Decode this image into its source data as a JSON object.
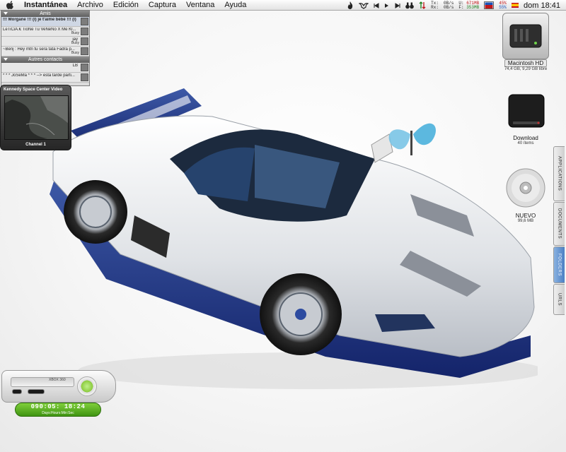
{
  "menubar": {
    "app_name": "Instantánea",
    "menus": [
      "Archivo",
      "Edición",
      "Captura",
      "Ventana",
      "Ayuda"
    ],
    "net": {
      "tx_label": "Tx:",
      "rx_label": "Rx:",
      "tx_val": "0B/s",
      "rx_val": "0B/s"
    },
    "mem": {
      "u_label": "U:",
      "f_label": "F:",
      "u_val": "671MB",
      "f_val": "353MB"
    },
    "cpu": {
      "top": "45%",
      "bottom": "55%"
    },
    "clock": "dom 18:41",
    "icons": [
      "apple-icon",
      "flame-icon",
      "bird-icon",
      "previous-track-icon",
      "play-pause-icon",
      "next-track-icon",
      "binoculars-icon",
      "network-activity-icon",
      "cpu-meter-icon",
      "spain-flag-icon"
    ]
  },
  "buddy_list": {
    "group1": "Amis",
    "group2": "Autres contacts",
    "contacts": [
      {
        "name": "!!! Morgane !!! (l) je t'aime bébé !!! (l)",
        "status": ""
      },
      {
        "name": "LeTiCiA.€ TioNe Tu VeNeNo X Me Kl...",
        "status": "Busy"
      },
      {
        "name": "",
        "status": "Busy",
        "sub": "jay"
      },
      {
        "name": "~Benj : Hey mtn tu sera tata Fadra p...",
        "status": "Busy"
      }
    ],
    "others": [
      {
        "name": "",
        "sub": "LB"
      },
      {
        "name": "* * * JoSeMa * * * --> esta tarde parti..."
      }
    ]
  },
  "video_widget": {
    "title": "Kennedy Space Center Video",
    "channel": "Channel 1"
  },
  "drives": [
    {
      "name": "Macintosh HD",
      "info": "74,4 GB, 9,29 GB libre"
    },
    {
      "name": "Download",
      "info": "40 ítems"
    },
    {
      "name": "NUEVO",
      "info": "99,6 MB"
    }
  ],
  "drawer_tabs": [
    {
      "label": "APPLICATIONS",
      "active": false
    },
    {
      "label": "DOCUMENTS",
      "active": false
    },
    {
      "label": "FOLDERS",
      "active": true
    },
    {
      "label": "URLS",
      "active": false
    }
  ],
  "xbox": {
    "brand": "XBOX 360"
  },
  "uptime": {
    "time": "090:05: 18:24",
    "label": "Days:Hours:Min:Sec"
  },
  "colors": {
    "accent_blue": "#1f3a8a",
    "uptime_green": "#5cb224",
    "drawer_active": "#4b7fc4"
  }
}
